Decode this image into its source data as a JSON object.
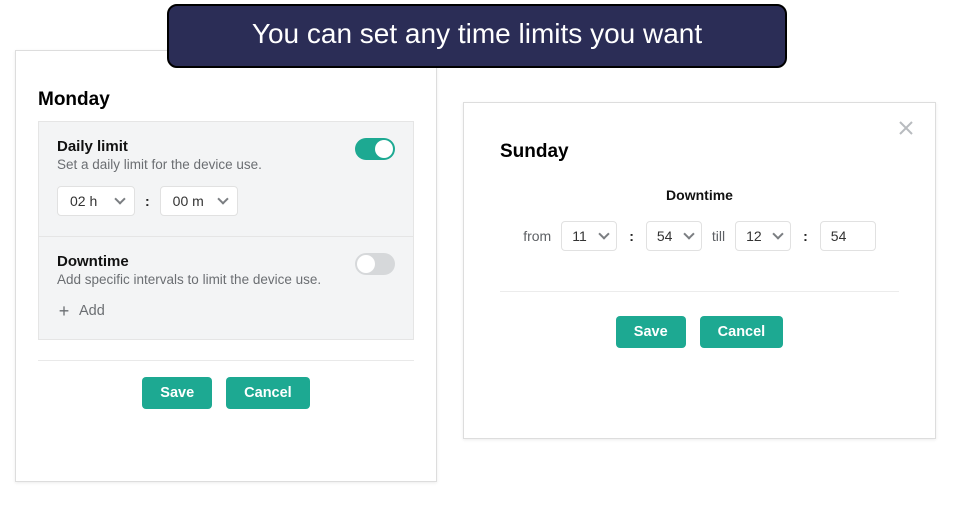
{
  "banner": {
    "text": "You can set any time limits you want"
  },
  "monday": {
    "day": "Monday",
    "daily_limit": {
      "title": "Daily limit",
      "desc": "Set a daily limit for the device use.",
      "hours": "02 h",
      "minutes": "00 m",
      "enabled": true
    },
    "downtime": {
      "title": "Downtime",
      "desc": "Add specific intervals to limit the device use.",
      "add_label": "Add",
      "enabled": false
    },
    "buttons": {
      "save": "Save",
      "cancel": "Cancel"
    }
  },
  "sunday": {
    "day": "Sunday",
    "downtime_label": "Downtime",
    "from_label": "from",
    "till_label": "till",
    "from_hour": "11",
    "from_min": "54",
    "till_hour": "12",
    "till_min": "54",
    "buttons": {
      "save": "Save",
      "cancel": "Cancel"
    }
  },
  "colors": {
    "accent": "#1da992",
    "banner_bg": "#2b2d56"
  }
}
